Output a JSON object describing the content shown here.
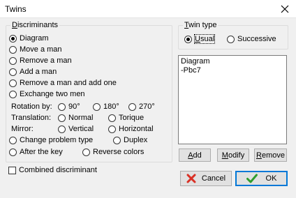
{
  "window": {
    "title": "Twins"
  },
  "discriminants": {
    "label": "Discriminants",
    "options": [
      {
        "label": "Diagram",
        "checked": true
      },
      {
        "label": "Move a man",
        "checked": false
      },
      {
        "label": "Remove a man",
        "checked": false
      },
      {
        "label": "Add a man",
        "checked": false
      },
      {
        "label": "Remove a man and add one",
        "checked": false
      },
      {
        "label": "Exchange two men",
        "checked": false
      }
    ],
    "rotation": {
      "label": "Rotation by:",
      "options": [
        "90°",
        "180°",
        "270°"
      ]
    },
    "translation": {
      "label": "Translation:",
      "options": [
        "Normal",
        "Torique"
      ]
    },
    "mirror": {
      "label": "Mirror:",
      "options": [
        "Vertical",
        "Horizontal"
      ]
    },
    "change_problem_type": "Change problem type",
    "duplex": "Duplex",
    "after_the_key": "After the key",
    "reverse_colors": "Reverse colors"
  },
  "combined_discriminant": {
    "label": "Combined discriminant",
    "checked": false
  },
  "twin_type": {
    "label": "Twin type",
    "options": [
      {
        "label": "Usual",
        "checked": true
      },
      {
        "label": "Successive",
        "checked": false
      }
    ]
  },
  "twin_list": {
    "items": [
      "Diagram",
      "-Pbc7"
    ]
  },
  "buttons": {
    "add": "Add",
    "modify": "Modify",
    "remove": "Remove",
    "cancel": "Cancel",
    "ok": "OK"
  },
  "colors": {
    "ok_check": "#2e9e2e",
    "cancel_x": "#d93025",
    "default_border": "#0078d7"
  }
}
